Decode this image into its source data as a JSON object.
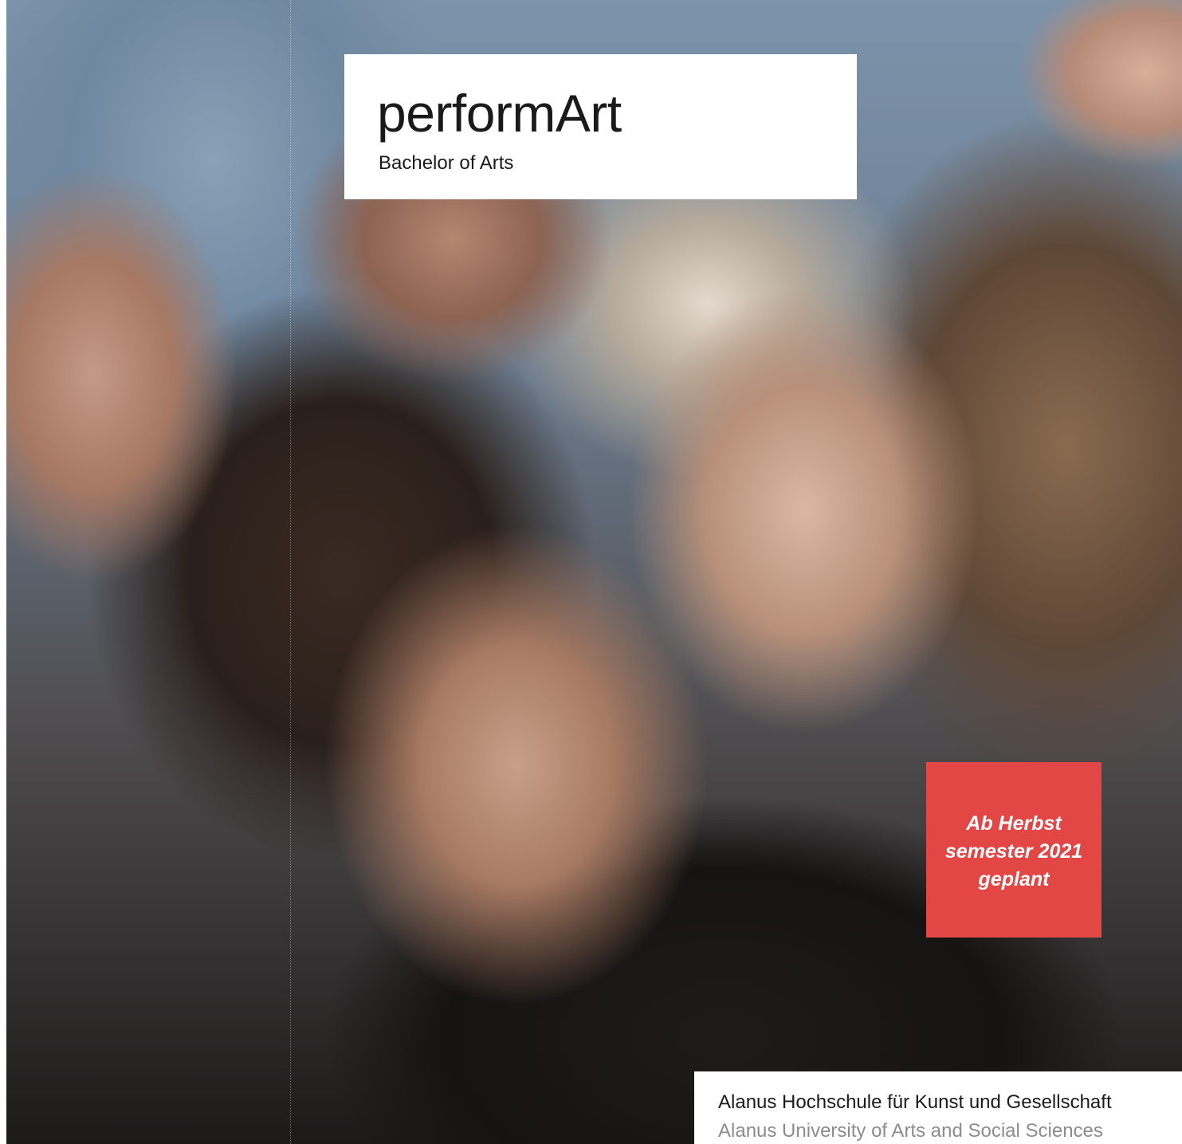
{
  "cover": {
    "title": "performArt",
    "subtitle": "Bachelor of Arts"
  },
  "badge": {
    "lines": [
      "Ab Herbst",
      "semester 2021",
      "geplant"
    ],
    "color": "#e24746"
  },
  "footer": {
    "institution_de": "Alanus Hochschule für Kunst und Gesellschaft",
    "institution_en": "Alanus University of Arts and Social Sciences"
  },
  "colors": {
    "text": "#1a1a1a",
    "secondary_text": "#8c8c8c",
    "panel": "#ffffff"
  }
}
